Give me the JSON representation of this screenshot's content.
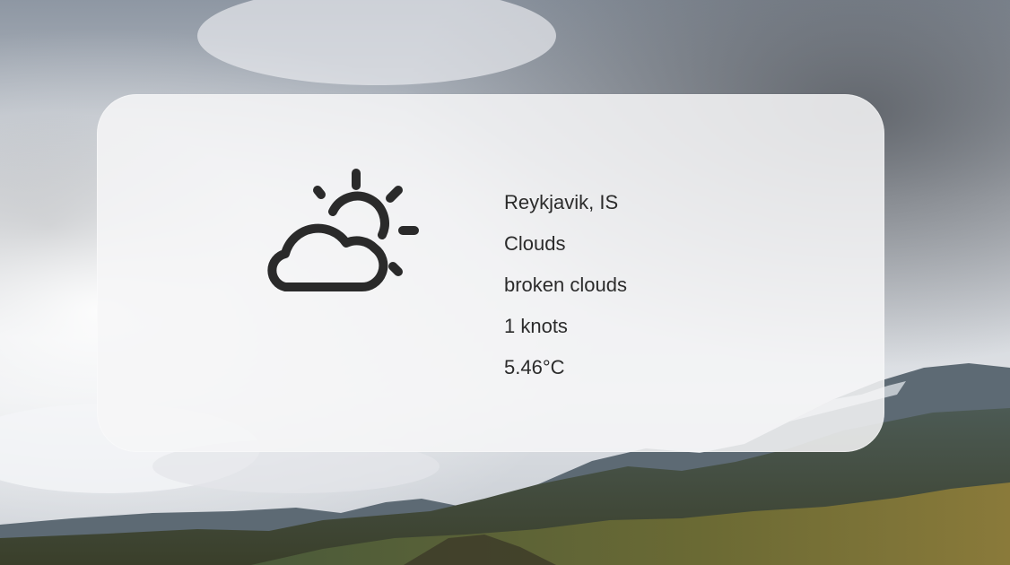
{
  "weather": {
    "location": "Reykjavik, IS",
    "condition": "Clouds",
    "description": "broken clouds",
    "wind": "1 knots",
    "temperature": "5.46°C",
    "icon": "partly-cloudy-icon"
  },
  "colors": {
    "text": "#2b2b2b",
    "icon": "#2a2a2a",
    "card": "#f6f6f7"
  }
}
